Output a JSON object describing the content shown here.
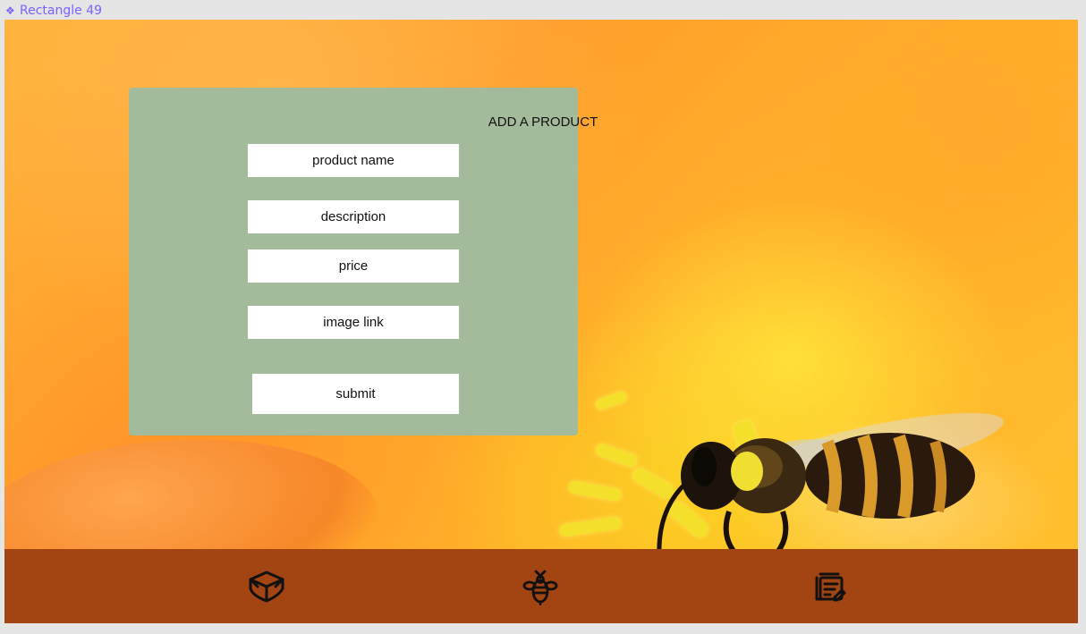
{
  "frame": {
    "label": "Rectangle 49",
    "label_icon": "component-diamond-icon",
    "accent_color": "#7b61ff"
  },
  "form": {
    "title": "ADD A PRODUCT",
    "fields": {
      "product_name": {
        "placeholder": "product name",
        "value": ""
      },
      "description": {
        "placeholder": "description",
        "value": ""
      },
      "price": {
        "placeholder": "price",
        "value": ""
      },
      "image_link": {
        "placeholder": "image link",
        "value": ""
      }
    },
    "submit_label": "submit",
    "panel_color": "#a3bb9a"
  },
  "bottom_nav": {
    "background_color": "#a34513",
    "items": [
      {
        "icon": "open-box-icon"
      },
      {
        "icon": "bee-icon"
      },
      {
        "icon": "notes-edit-icon"
      }
    ]
  }
}
